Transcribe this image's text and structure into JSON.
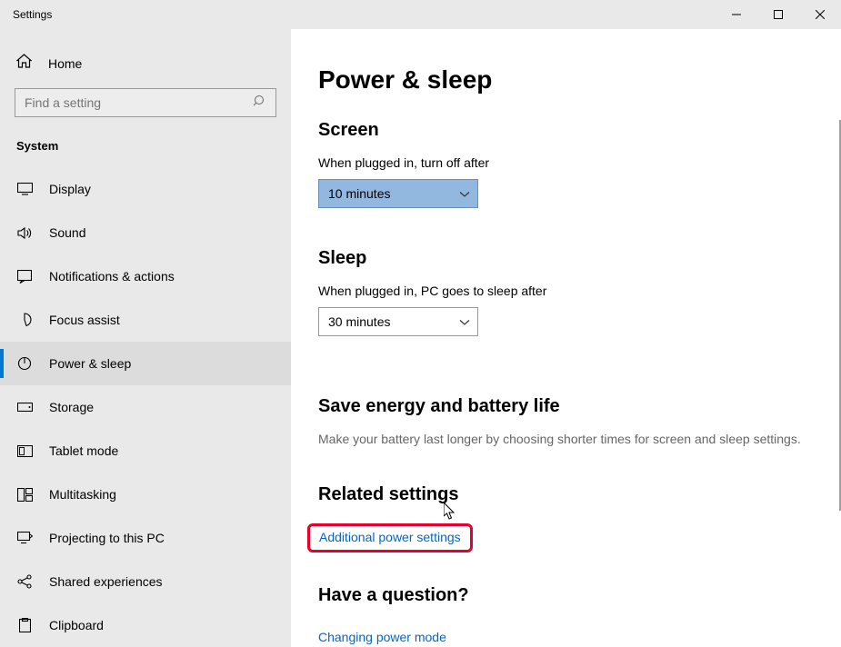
{
  "window": {
    "title": "Settings"
  },
  "sidebar": {
    "home": "Home",
    "search_placeholder": "Find a setting",
    "section": "System",
    "items": [
      {
        "label": "Display"
      },
      {
        "label": "Sound"
      },
      {
        "label": "Notifications & actions"
      },
      {
        "label": "Focus assist"
      },
      {
        "label": "Power & sleep"
      },
      {
        "label": "Storage"
      },
      {
        "label": "Tablet mode"
      },
      {
        "label": "Multitasking"
      },
      {
        "label": "Projecting to this PC"
      },
      {
        "label": "Shared experiences"
      },
      {
        "label": "Clipboard"
      }
    ]
  },
  "main": {
    "title": "Power & sleep",
    "screen_heading": "Screen",
    "screen_label": "When plugged in, turn off after",
    "screen_value": "10 minutes",
    "sleep_heading": "Sleep",
    "sleep_label": "When plugged in, PC goes to sleep after",
    "sleep_value": "30 minutes",
    "save_heading": "Save energy and battery life",
    "save_subtext": "Make your battery last longer by choosing shorter times for screen and sleep settings.",
    "related_heading": "Related settings",
    "related_link": "Additional power settings",
    "question_heading": "Have a question?",
    "question_link": "Changing power mode"
  }
}
